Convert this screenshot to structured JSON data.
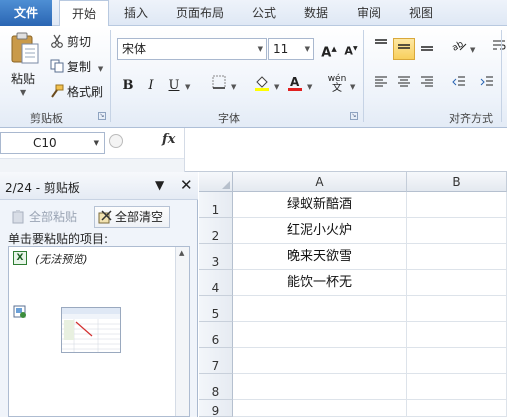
{
  "tabs": [
    "文件",
    "开始",
    "插入",
    "页面布局",
    "公式",
    "数据",
    "审阅",
    "视图"
  ],
  "clipboard_group": {
    "paste_label": "粘贴",
    "cut_label": "剪切",
    "copy_label": "复制",
    "format_painter_label": "格式刷",
    "group_label": "剪贴板"
  },
  "font_group": {
    "font_name": "宋体",
    "font_size": "11",
    "bold": "B",
    "italic": "I",
    "underline": "U",
    "grow": "A",
    "shrink": "A",
    "phonetic": "wén",
    "group_label": "字体"
  },
  "align_group": {
    "group_label": "对齐方式"
  },
  "formula_bar": {
    "name_box": "C10",
    "fx": "fx",
    "formula": ""
  },
  "pane": {
    "title": "2/24 - 剪贴板",
    "paste_all": "全部粘贴",
    "clear_all": "全部清空",
    "hint": "单击要粘贴的项目:",
    "item1_text": "(无法预览)"
  },
  "sheet": {
    "columns": [
      "A",
      "B"
    ],
    "rows": [
      "1",
      "2",
      "3",
      "4",
      "5",
      "6",
      "7",
      "8",
      "9"
    ],
    "cells_a": [
      "绿蚁新醅酒",
      "红泥小火炉",
      "晚来天欲雪",
      "能饮一杯无",
      "",
      "",
      "",
      "",
      ""
    ]
  },
  "colors": {
    "file_tab": "#2a65b3",
    "active_button": "#f8cf5c",
    "ribbon_bg": "#eef3fa"
  }
}
